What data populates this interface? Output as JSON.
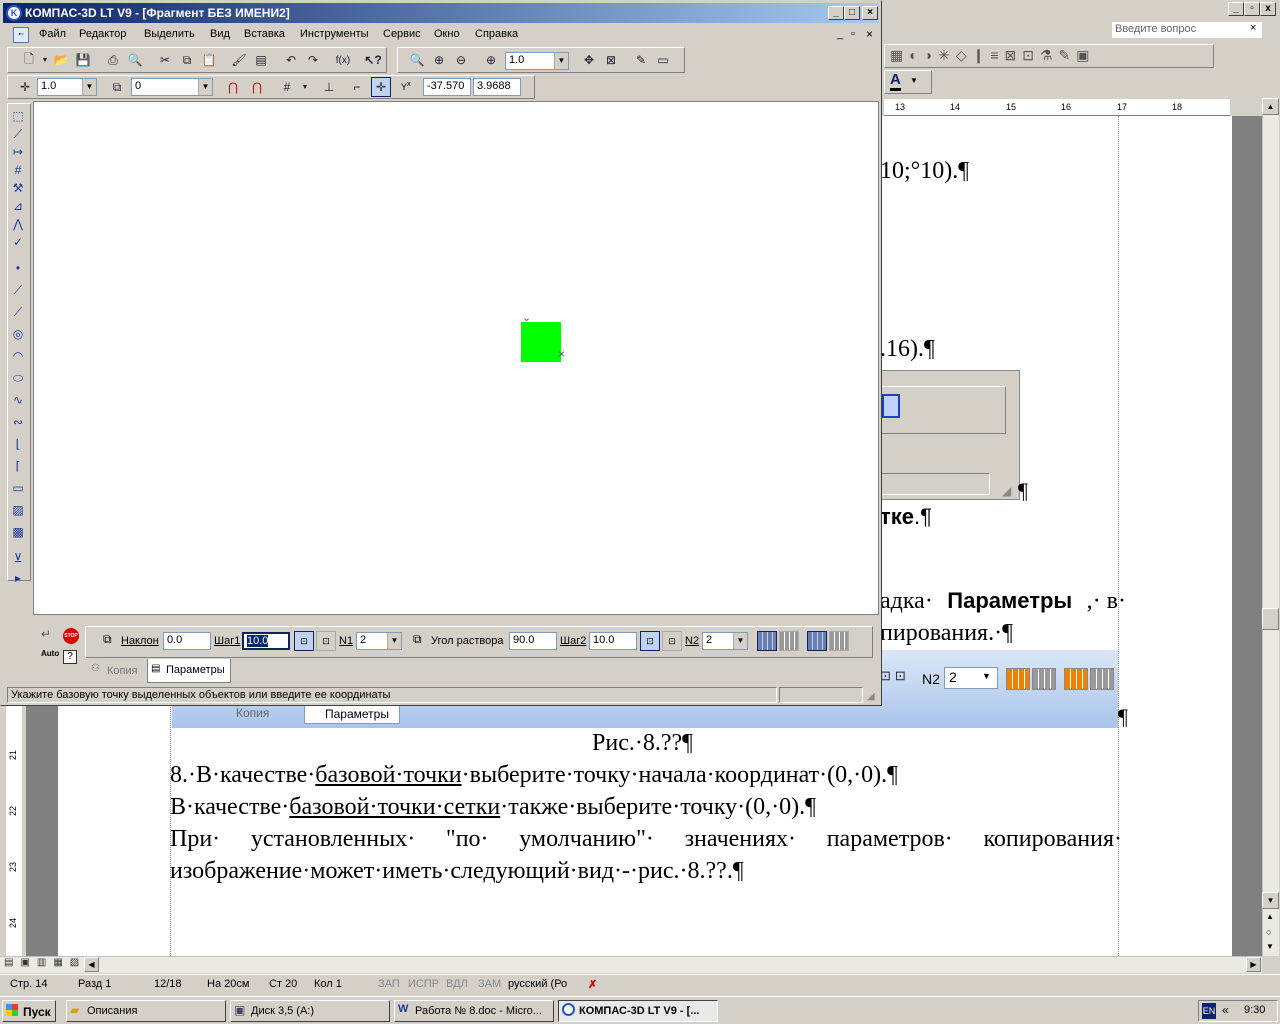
{
  "kompas": {
    "title": "КОМПАС-3D LT V9 - [Фрагмент БЕЗ ИМЕНИ2]",
    "menu": [
      "Файл",
      "Редактор",
      "Выделить",
      "Вид",
      "Вставка",
      "Инструменты",
      "Сервис",
      "Окно",
      "Справка"
    ],
    "scale_value": "1.0",
    "style_value": "1.0",
    "layer_value": "0",
    "coord_x": "-37.570",
    "coord_y": "3.9688",
    "params": {
      "naklon_label": "Наклон",
      "naklon_value": "0.0",
      "shag1_label": "Шаг1",
      "shag1_value": "10.0",
      "n1_label": "N1",
      "n1_value": "2",
      "ugol_label": "Угол раствора",
      "ugol_value": "90.0",
      "shag2_label": "Шаг2",
      "shag2_value": "10.0",
      "n2_label": "N2",
      "n2_value": "2"
    },
    "tabs": [
      "Копия",
      "Параметры"
    ],
    "auto_label": "Auto",
    "status": "Укажите базовую точку выделенных объектов или введите ее координаты"
  },
  "word": {
    "ask_placeholder": "Введите вопрос",
    "ruler_numbers": [
      "13",
      "14",
      "15",
      "16",
      "17",
      "18"
    ],
    "vruler_numbers": [
      "21",
      "22",
      "23",
      "24"
    ],
    "visible_fragments": {
      "f1": "10;°10).¶",
      "f2": ".16).¶",
      "f3": "¶",
      "f4_bold": "тке",
      "f4_tail": ".¶",
      "f5_pre": "адка·",
      "f5_bold": "Параметры",
      "f5_post": ",· в·",
      "f6": "пирования.·¶"
    },
    "embedded_panel": {
      "n2_label": "N2",
      "n2_value": "2",
      "tabs": [
        "Копия",
        "Параметры"
      ],
      "pilcrow": "¶"
    },
    "caption": "Рис.·8.??¶",
    "para1_pre": "8.·В·качестве·",
    "para1_link": "базовой·точки",
    "para1_post": "·выберите·точку·начала·координат·(0,·0).¶",
    "para2_pre": "В·качестве·",
    "para2_link": "базовой·точки·сетки",
    "para2_post": "·также·выберите·точку·(0,·0).¶",
    "para3_line1": "При· установленных· \"по· умолчанию\"· значениях· параметров· копирования·",
    "para3_line2": "изображение·может·иметь·следующий·вид·-·рис.·8.??.¶",
    "statusbar": {
      "page": "Стр. 14",
      "section": "Разд 1",
      "pages": "12/18",
      "at": "На 20см",
      "line": "Ст 20",
      "col": "Кол 1",
      "rec": "ЗАП",
      "trk": "ИСПР",
      "ext": "ВДЛ",
      "ovr": "ЗАМ",
      "lang": "русский (Ро"
    }
  },
  "taskbar": {
    "start": "Пуск",
    "items": [
      "Описания",
      "Диск 3,5 (A:)",
      "Работа № 8.doc - Micro...",
      "КОМПАС-3D LT V9 - [..."
    ],
    "lang": "EN",
    "time": "9:30"
  },
  "colors": {
    "title_active": "#0a246a",
    "title_gradient_end": "#a6caf0",
    "green_square": "#00ff00",
    "desktop": "#d4d0c8"
  }
}
